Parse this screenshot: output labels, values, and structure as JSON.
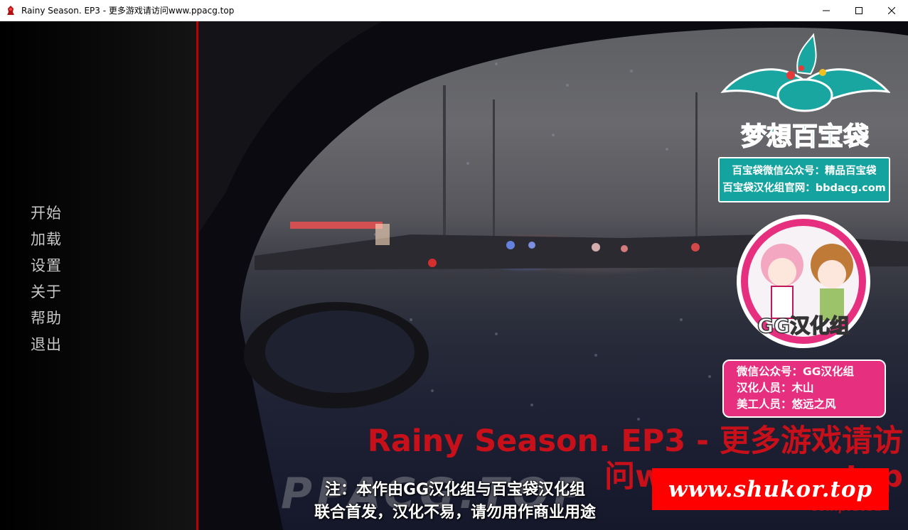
{
  "window": {
    "title": "Rainy Season. EP3 - 更多游戏请访问www.ppacg.top",
    "icon": "red-lamp-icon",
    "controls": [
      "minimize-icon",
      "maximize-icon",
      "close-icon"
    ]
  },
  "menu": {
    "items": [
      {
        "label": "开始"
      },
      {
        "label": "加载"
      },
      {
        "label": "设置"
      },
      {
        "label": "关于"
      },
      {
        "label": "帮助"
      },
      {
        "label": "退出"
      }
    ]
  },
  "badges": {
    "bbd_logo_text": "梦想百宝袋",
    "bbd_line1": "百宝袋微信公众号：精品百宝袋",
    "bbd_line2": "百宝袋汉化组官网：bbdacg.com",
    "gg_logo_text": "GG汉化组",
    "gg_line1": "微信公众号：GG汉化组",
    "gg_line2": "汉化人员：木山",
    "gg_line3": "美工人员：悠远之风"
  },
  "overlay": {
    "game_title": "Rainy Season. EP3 - 更多游戏请访问www.ppacg.top",
    "completed": "completed",
    "watermark": "PPACG.TOP",
    "notice_line1": "注：本作由GG汉化组与百宝袋汉化组",
    "notice_line2": "联合首发，汉化不易，请勿用作商业用途",
    "shukor": "www.shukor.top"
  },
  "colors": {
    "accent_red": "#c00000",
    "title_red": "#c8101a",
    "bbd_teal": "#15a3a0",
    "gg_pink": "#e6307f",
    "shukor_red": "#ff0000"
  }
}
